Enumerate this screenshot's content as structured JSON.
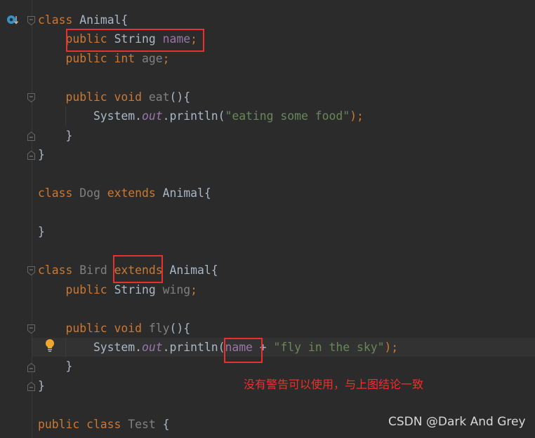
{
  "editor": {
    "lines": [
      [
        {
          "t": "class ",
          "c": "kw"
        },
        {
          "t": "Animal{",
          "c": "id"
        }
      ],
      [
        {
          "t": "    public ",
          "c": "kw"
        },
        {
          "t": "String ",
          "c": "id"
        },
        {
          "t": "name",
          "c": "fd"
        },
        {
          "t": ";",
          "c": "kw"
        }
      ],
      [
        {
          "t": "    public int ",
          "c": "kw"
        },
        {
          "t": "age",
          "c": "gr"
        },
        {
          "t": ";",
          "c": "kw"
        }
      ],
      [],
      [
        {
          "t": "    public void ",
          "c": "kw"
        },
        {
          "t": "eat",
          "c": "gr"
        },
        {
          "t": "(){",
          "c": "pl"
        }
      ],
      [
        {
          "t": "        System.",
          "c": "id"
        },
        {
          "t": "out",
          "c": "it"
        },
        {
          "t": ".println(",
          "c": "id"
        },
        {
          "t": "\"eating some food\"",
          "c": "st"
        },
        {
          "t": ");",
          "c": "kw"
        }
      ],
      [
        {
          "t": "    }",
          "c": "pl"
        }
      ],
      [
        {
          "t": "}",
          "c": "pl"
        }
      ],
      [],
      [
        {
          "t": "class ",
          "c": "kw"
        },
        {
          "t": "Dog ",
          "c": "gr"
        },
        {
          "t": "extends ",
          "c": "kw"
        },
        {
          "t": "Animal{",
          "c": "id"
        }
      ],
      [],
      [
        {
          "t": "}",
          "c": "pl"
        }
      ],
      [],
      [
        {
          "t": "class ",
          "c": "kw"
        },
        {
          "t": "Bird ",
          "c": "gr"
        },
        {
          "t": "extends ",
          "c": "kw"
        },
        {
          "t": "Animal{",
          "c": "id"
        }
      ],
      [
        {
          "t": "    public ",
          "c": "kw"
        },
        {
          "t": "String ",
          "c": "id"
        },
        {
          "t": "wing",
          "c": "gr"
        },
        {
          "t": ";",
          "c": "kw"
        }
      ],
      [],
      [
        {
          "t": "    public void ",
          "c": "kw"
        },
        {
          "t": "fly",
          "c": "gr"
        },
        {
          "t": "(){",
          "c": "pl"
        }
      ],
      [
        {
          "t": "        System.",
          "c": "id"
        },
        {
          "t": "out",
          "c": "it"
        },
        {
          "t": ".println(",
          "c": "id"
        },
        {
          "t": "name",
          "c": "fd"
        },
        {
          "t": " + ",
          "c": "pl"
        },
        {
          "t": "\"fly in the sky\"",
          "c": "st"
        },
        {
          "t": ");",
          "c": "kw"
        }
      ],
      [
        {
          "t": "    }",
          "c": "pl"
        }
      ],
      [
        {
          "t": "}",
          "c": "pl"
        }
      ],
      [],
      [
        {
          "t": "public class ",
          "c": "kw"
        },
        {
          "t": "Test ",
          "c": "gr"
        },
        {
          "t": "{",
          "c": "pl"
        }
      ]
    ]
  },
  "annotation": "没有警告可以使用，与上图结论一致",
  "watermark": "CSDN @Dark And Grey",
  "colors": {
    "highlight_box": "#e8302f",
    "keyword": "#cc7832",
    "field": "#9876aa",
    "string": "#6a8759"
  },
  "icons": {
    "override": "override-icon",
    "bulb": "lightbulb-icon",
    "fold": "fold-marker-icon"
  }
}
